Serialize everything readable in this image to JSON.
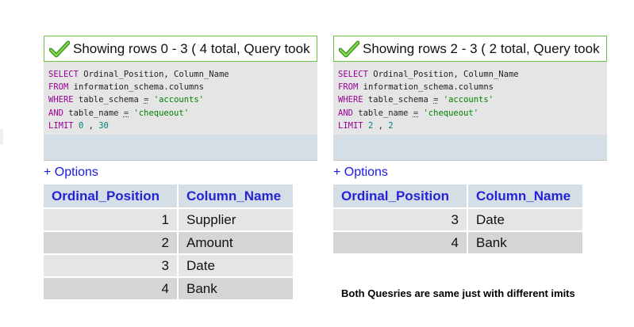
{
  "left": {
    "banner": "Showing rows 0 - 3 ( 4 total, Query took",
    "sql": [
      [
        [
          "kw",
          "SELECT"
        ],
        [
          "t",
          " Ordinal_Position, Column_Name"
        ]
      ],
      [
        [
          "kw",
          "FROM"
        ],
        [
          "t",
          " information_schema.columns"
        ]
      ],
      [
        [
          "kw",
          "WHERE"
        ],
        [
          "t",
          " table_schema "
        ],
        [
          "op",
          "="
        ],
        [
          "t",
          " "
        ],
        [
          "str",
          "'accounts'"
        ]
      ],
      [
        [
          "kw",
          "AND"
        ],
        [
          "t",
          " table_name "
        ],
        [
          "op",
          "="
        ],
        [
          "t",
          " "
        ],
        [
          "str",
          "'chequeout'"
        ]
      ],
      [
        [
          "kw",
          "LIMIT"
        ],
        [
          "t",
          " "
        ],
        [
          "num",
          "0"
        ],
        [
          "t",
          " , "
        ],
        [
          "num",
          "30"
        ]
      ]
    ],
    "options": "+ Options",
    "headers": [
      "Ordinal_Position",
      "Column_Name"
    ],
    "rows": [
      [
        "1",
        "Supplier"
      ],
      [
        "2",
        "Amount"
      ],
      [
        "3",
        "Date"
      ],
      [
        "4",
        "Bank"
      ]
    ]
  },
  "right": {
    "banner": "Showing rows 2 - 3 ( 2 total, Query took",
    "sql": [
      [
        [
          "kw",
          "SELECT"
        ],
        [
          "t",
          " Ordinal_Position, Column_Name"
        ]
      ],
      [
        [
          "kw",
          "FROM"
        ],
        [
          "t",
          " information_schema.columns"
        ]
      ],
      [
        [
          "kw",
          "WHERE"
        ],
        [
          "t",
          " table_schema "
        ],
        [
          "op",
          "="
        ],
        [
          "t",
          " "
        ],
        [
          "str",
          "'accounts'"
        ]
      ],
      [
        [
          "kw",
          "AND"
        ],
        [
          "t",
          " table_name "
        ],
        [
          "op",
          "="
        ],
        [
          "t",
          " "
        ],
        [
          "str",
          "'chequeout'"
        ]
      ],
      [
        [
          "kw",
          "LIMIT"
        ],
        [
          "t",
          " "
        ],
        [
          "num",
          "2"
        ],
        [
          "t",
          " , "
        ],
        [
          "num",
          "2"
        ]
      ]
    ],
    "options": "+ Options",
    "headers": [
      "Ordinal_Position",
      "Column_Name"
    ],
    "rows": [
      [
        "3",
        "Date"
      ],
      [
        "4",
        "Bank"
      ]
    ]
  },
  "note": "Both Quesries are same just with different imits",
  "icons": {
    "banner": "checkmark-icon"
  },
  "colors": {
    "header_text": "#2424d6",
    "keyword": "#990099",
    "string": "#008000",
    "banner_border": "#6cc044"
  }
}
